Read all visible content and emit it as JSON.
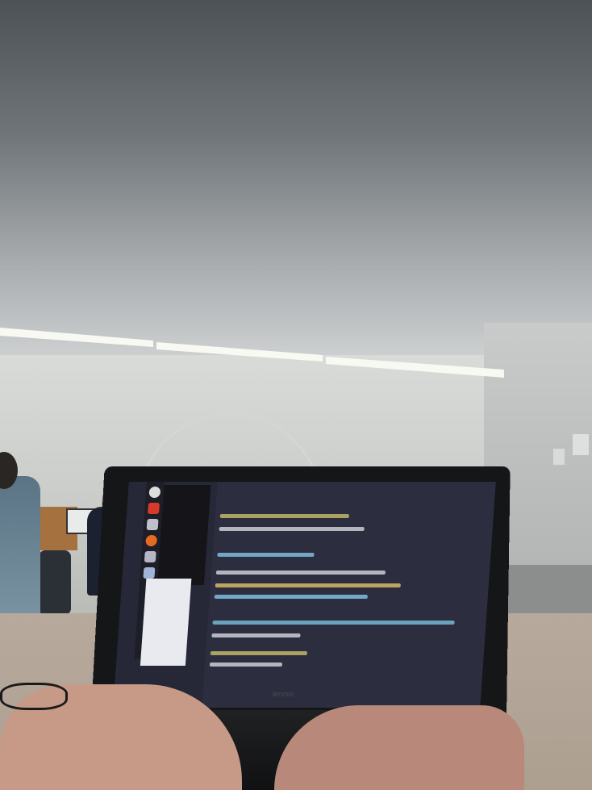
{
  "scene": {
    "description_labels": {
      "brand_text": "lenovo"
    },
    "colors": {
      "editor_background": "#2c2d3f",
      "launcher_background": "#1d1e27",
      "desk": "#b7a99c",
      "ceiling_light": "#f7f9f2"
    },
    "icons": [
      "ubuntu-launcher-icon",
      "files-icon",
      "firefox-icon",
      "text-editor-icon",
      "settings-icon",
      "terminal-icon"
    ]
  }
}
